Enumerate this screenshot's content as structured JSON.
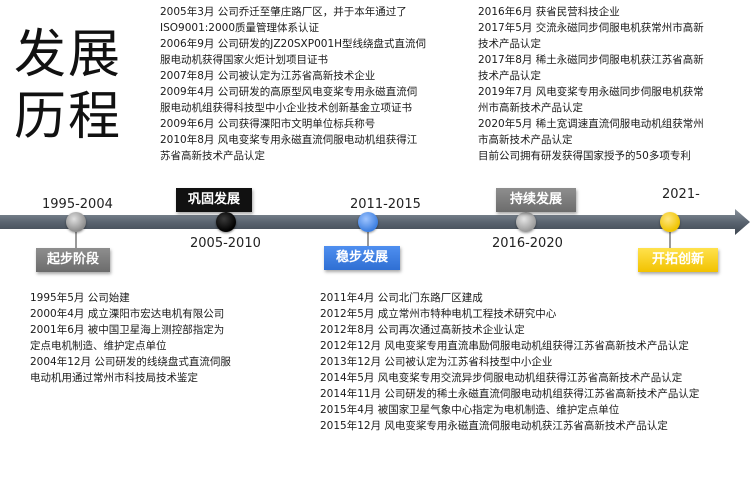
{
  "page": {
    "title_line1": "发展",
    "title_line2": "历程"
  },
  "timeline": {
    "years": [
      "1995-2004",
      "2005-2010",
      "2011-2015",
      "2016-2020",
      "2021-"
    ],
    "stages": [
      "起步阶段",
      "巩固发展",
      "稳步发展",
      "持续发展",
      "开拓创新"
    ],
    "colors": {
      "line": "#5a6470",
      "stage_1": "#7d7d7d",
      "stage_2": "#111111",
      "stage_3": "#3b7be0",
      "stage_4": "#7d7d7d",
      "stage_5": "#f5c800"
    }
  },
  "blocks": {
    "top_left": [
      "2005年3月   公司乔迁至肇庄路厂区，并于本年通过了",
      "ISO9001:2000质量管理体系认证",
      "2006年9月   公司研发的JZ20SXP001H型线绕盘式直流伺",
      "服电动机获得国家火炬计划项目证书",
      "2007年8月   公司被认定为江苏省高新技术企业",
      "2009年4月   公司研发的高原型风电变桨专用永磁直流伺",
      "服电动机组获得科技型中小企业技术创新基金立项证书",
      "2009年6月   公司获得溧阳市文明单位标兵称号",
      "2010年8月   风电变桨专用永磁直流伺服电动机组获得江",
      "苏省高新技术产品认定"
    ],
    "top_right": [
      "2016年6月   获省民营科技企业",
      "2017年5月   交流永磁同步伺服电机获常州市高新",
      "技术产品认定",
      "2017年8月   稀土永磁同步伺服电机获江苏省高新",
      "技术产品认定",
      "2019年7月   风电变桨专用永磁同步伺服电机获常",
      "州市高新技术产品认定",
      "2020年5月   稀土宽调速直流伺服电动机组获常州",
      "市高新技术产品认定",
      "目前公司拥有研发获得国家授予的50多项专利"
    ],
    "bottom_left": [
      "1995年5月    公司始建",
      "2000年4月    成立溧阳市宏达电机有限公司",
      "2001年6月    被中国卫星海上测控部指定为",
      "定点电机制造、维护定点单位",
      "2004年12月  公司研发的线绕盘式直流伺服",
      "电动机用通过常州市科技局技术鉴定"
    ],
    "bottom_mid": [
      "2011年4月    公司北门东路厂区建成",
      "2012年5月    成立常州市特种电机工程技术研究中心",
      "2012年8月    公司再次通过高新技术企业认定",
      "2012年12月  风电变桨专用直流串励伺服电动机组获得江苏省高新技术产品认定",
      "2013年12月  公司被认定为江苏省科技型中小企业",
      "2014年5月    风电变桨专用交流异步伺服电动机组获得江苏省高新技术产品认定",
      "2014年11月  公司研发的稀土永磁直流伺服电动机组获得江苏省高新技术产品认定",
      "2015年4月    被国家卫星气象中心指定为电机制造、维护定点单位",
      "2015年12月    风电变桨专用永磁直流伺服电动机获江苏省高新技术产品认定"
    ]
  }
}
